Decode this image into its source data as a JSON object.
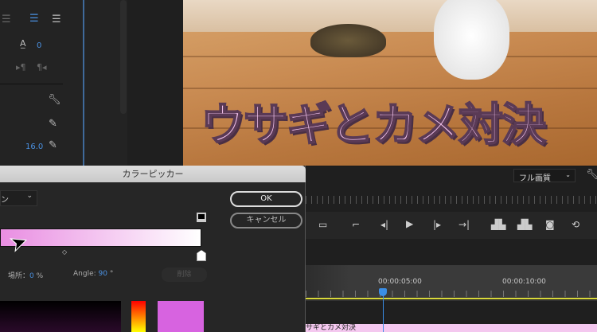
{
  "left_panel": {
    "tracking_value": "0",
    "size_value": "16.0"
  },
  "video": {
    "caption": "ウサギとカメ対決"
  },
  "dialog": {
    "title": "カラーピッカー",
    "mode_dropdown": "ン",
    "ok": "OK",
    "cancel": "キャンセル",
    "location_label": "場所：",
    "location_value": "0",
    "location_unit": "%",
    "angle_label": "Angle:",
    "angle_value": "90",
    "angle_unit": "°",
    "delete": "削除",
    "gradient_colors": [
      "#e98ee2",
      "#ffffff"
    ],
    "swatch_color": "#d763e0"
  },
  "monitor": {
    "quality": "フル画質",
    "timecodes": [
      "00:00:05:00",
      "00:00:10:00"
    ],
    "clip_label": "サギとカメ対決"
  }
}
